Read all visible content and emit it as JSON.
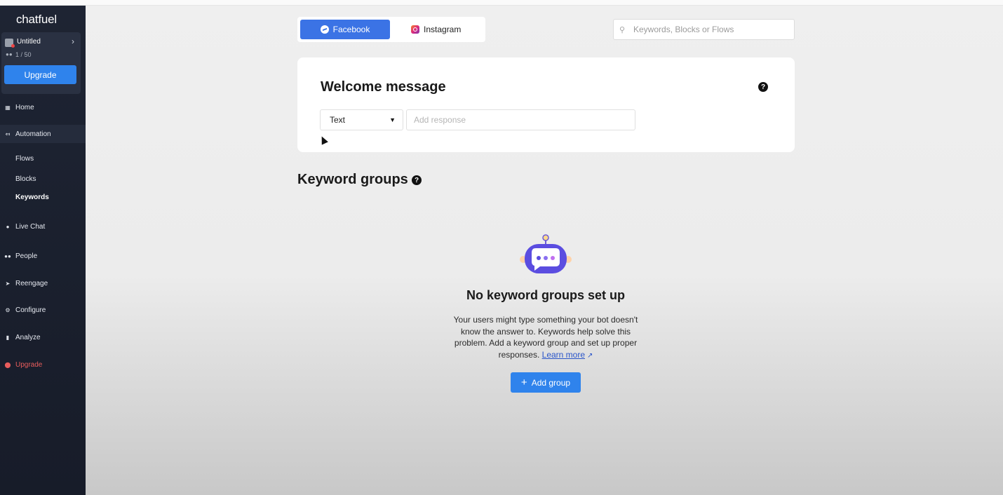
{
  "sidebar": {
    "brand": "chatfuel",
    "workspace": {
      "name": "Untitled",
      "users": "1 / 50"
    },
    "upgrade_button": "Upgrade",
    "nav": {
      "home": "Home",
      "automation": "Automation",
      "flows": "Flows",
      "blocks": "Blocks",
      "keywords": "Keywords",
      "live_chat": "Live Chat",
      "people": "People",
      "reengage": "Reengage",
      "configure": "Configure",
      "analyze": "Analyze",
      "upgrade": "Upgrade"
    }
  },
  "header": {
    "tabs": {
      "facebook": "Facebook",
      "instagram": "Instagram"
    },
    "search": {
      "placeholder": "Keywords, Blocks or Flows"
    }
  },
  "welcome": {
    "title": "Welcome message",
    "type_value": "Text",
    "response_placeholder": "Add response"
  },
  "keywords": {
    "title": "Keyword groups",
    "empty_title": "No keyword groups set up",
    "empty_desc": "Your users might type something your bot doesn't know the answer to. Keywords help solve this problem. Add a keyword group and set up proper responses.",
    "learn_more": "Learn more",
    "add_button": "Add group"
  },
  "colors": {
    "accent": "#2f83ec",
    "sidebar_bg": "#1e2433",
    "upgrade_red": "#e85c5c"
  }
}
